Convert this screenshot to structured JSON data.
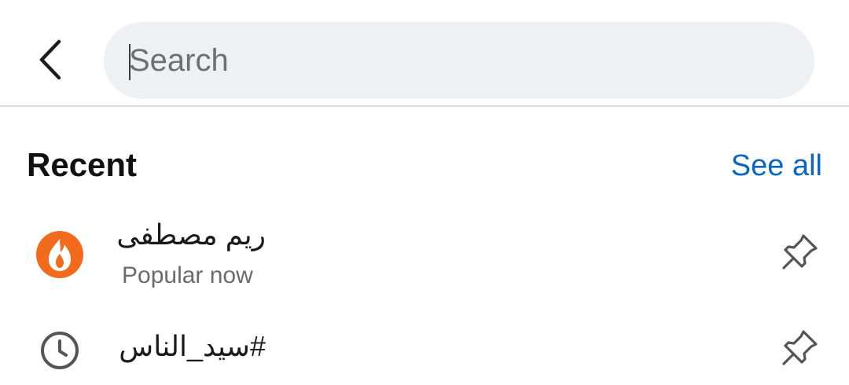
{
  "header": {
    "back_icon": "back-chevron-icon",
    "search": {
      "value": "",
      "placeholder": "Search"
    }
  },
  "recent": {
    "title": "Recent",
    "see_all_label": "See all",
    "items": [
      {
        "title": "ريم مصطفى",
        "subtitle": "Popular now",
        "leading_icon": "trending-fire-icon",
        "trailing_icon": "pin-icon",
        "accent": "#f26b1d"
      },
      {
        "title": "#سيد_الناس",
        "subtitle": "",
        "leading_icon": "history-clock-icon",
        "trailing_icon": "pin-icon"
      }
    ]
  },
  "colors": {
    "link": "#0a66c2",
    "search_bg": "#eef0f4",
    "divider": "#dcdcdc",
    "text_primary": "#111111",
    "text_secondary": "#6b6b6b"
  }
}
